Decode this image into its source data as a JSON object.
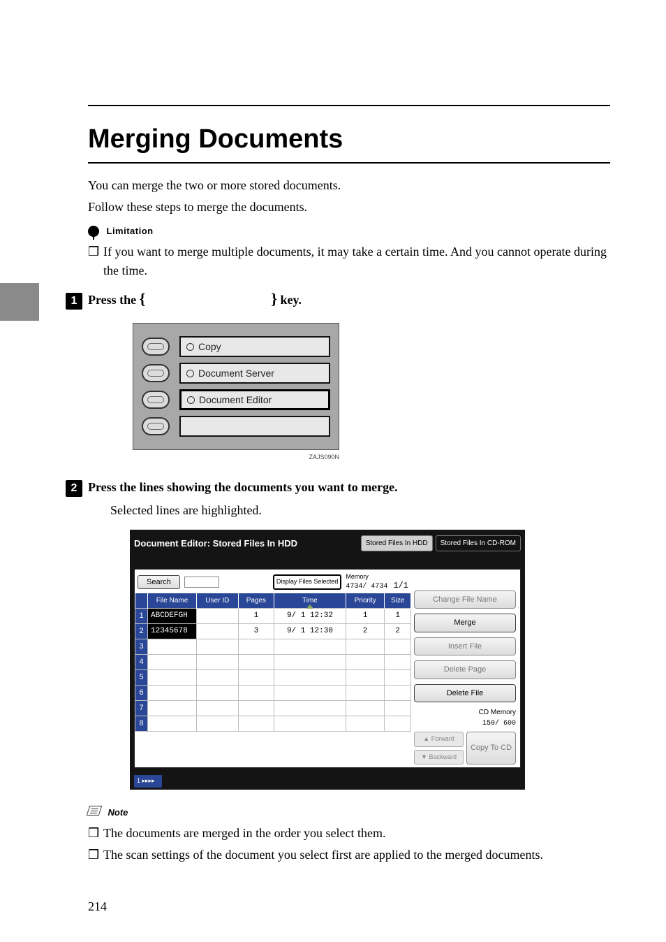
{
  "page_number": "214",
  "title": "Merging Documents",
  "intro_line1": "You can merge the two or more stored documents.",
  "intro_line2": "Follow these steps to merge the documents.",
  "limitation_heading": "Limitation",
  "limitation_item": "If you want to merge multiple documents, it may take a certain time. And you cannot operate during the time.",
  "step1": {
    "num": "1",
    "prefix": "Press the ",
    "key_name": "Document Editor",
    "suffix": " key."
  },
  "panel1": {
    "buttons": [
      "Copy",
      "Document Server",
      "Document Editor",
      ""
    ],
    "selected_index": 2,
    "code": "ZAJS090N"
  },
  "step2": {
    "num": "2",
    "text": "Press the lines showing the documents you want to merge.",
    "sub": "Selected lines are highlighted."
  },
  "screenshot": {
    "title": "Document Editor: Stored Files In HDD",
    "tabs": [
      "Stored Files In HDD",
      "Stored Files In CD-ROM"
    ],
    "search_label": "Search",
    "display_selected_label": "Display Files Selected",
    "memory_label": "Memory",
    "memory_vals": "4734/   4734",
    "page_indicator": "1/1",
    "columns": [
      "File Name",
      "User ID",
      "Pages",
      "Time",
      "Priority",
      "Size"
    ],
    "rows": [
      {
        "n": "1",
        "file": "ABCDEFGH",
        "user": "",
        "pages": "1",
        "time": "9/ 1 12:32",
        "priority": "1",
        "size": "1"
      },
      {
        "n": "2",
        "file": "12345678",
        "user": "",
        "pages": "3",
        "time": "9/ 1 12:30",
        "priority": "2",
        "size": "2"
      },
      {
        "n": "3",
        "file": "",
        "user": "",
        "pages": "",
        "time": "",
        "priority": "",
        "size": ""
      },
      {
        "n": "4",
        "file": "",
        "user": "",
        "pages": "",
        "time": "",
        "priority": "",
        "size": ""
      },
      {
        "n": "5",
        "file": "",
        "user": "",
        "pages": "",
        "time": "",
        "priority": "",
        "size": ""
      },
      {
        "n": "6",
        "file": "",
        "user": "",
        "pages": "",
        "time": "",
        "priority": "",
        "size": ""
      },
      {
        "n": "7",
        "file": "",
        "user": "",
        "pages": "",
        "time": "",
        "priority": "",
        "size": ""
      },
      {
        "n": "8",
        "file": "",
        "user": "",
        "pages": "",
        "time": "",
        "priority": "",
        "size": ""
      }
    ],
    "right_buttons": {
      "change_name": "Change File Name",
      "merge": "Merge",
      "insert": "Insert File",
      "delete_page": "Delete Page",
      "delete_file": "Delete File",
      "cd_memory_label": "CD Memory",
      "cd_memory_val": "150/    600",
      "forward": "Forward",
      "backward": "Backward",
      "copy_to_cd": "Copy To CD"
    },
    "page_tab": "1"
  },
  "note_heading": "Note",
  "note_items": [
    "The documents are merged in the order you select them.",
    "The scan settings of the document you select first are applied to the merged documents."
  ]
}
